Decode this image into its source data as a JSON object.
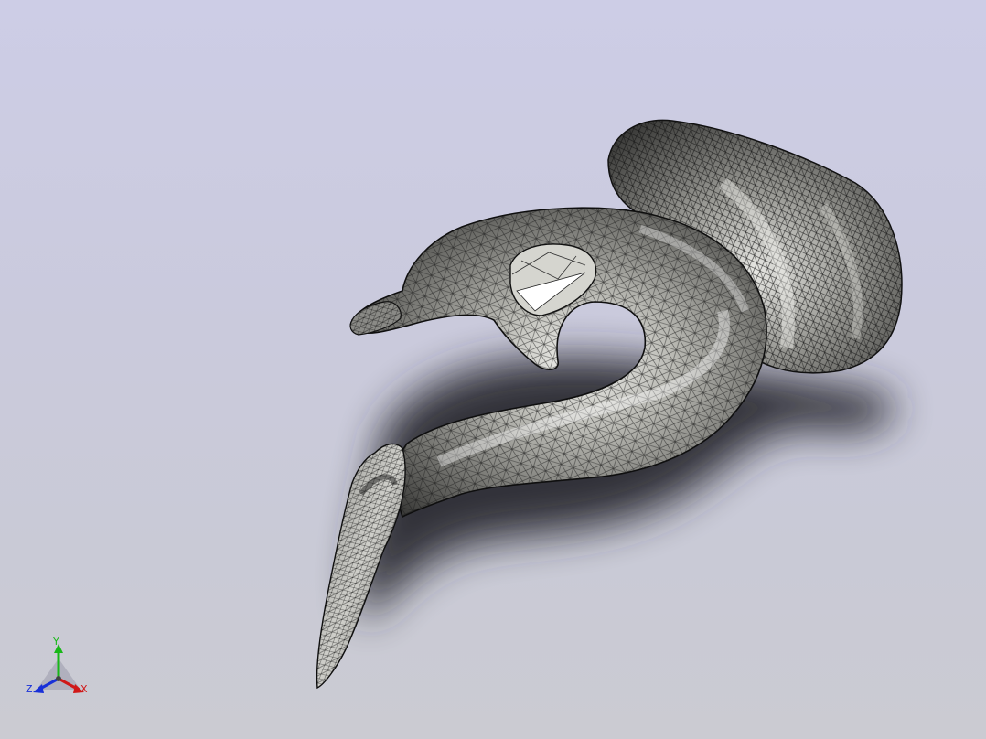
{
  "view": {
    "background_top": "#cdcde6",
    "background_bottom": "#cbcbd2",
    "model_fill": "#b9b9b3",
    "mesh_color": "#1a1a1a"
  },
  "triad": {
    "x_label": "X",
    "y_label": "Y",
    "z_label": "Z",
    "x_color": "#d01818",
    "y_color": "#18b818",
    "z_color": "#1830d8"
  }
}
